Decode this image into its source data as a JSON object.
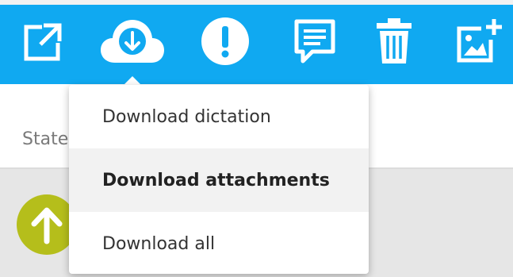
{
  "toolbar": {
    "background": "#10a9f1",
    "icon_color": "#ffffff",
    "buttons": [
      {
        "name": "open-external",
        "icon": "external-link-icon"
      },
      {
        "name": "download",
        "icon": "cloud-download-icon"
      },
      {
        "name": "priority",
        "icon": "exclamation-icon"
      },
      {
        "name": "comment",
        "icon": "comment-icon"
      },
      {
        "name": "delete",
        "icon": "trash-icon"
      },
      {
        "name": "add-image",
        "icon": "add-image-icon"
      }
    ]
  },
  "content": {
    "state_label": "State"
  },
  "download_menu": {
    "items": [
      {
        "label": "Download dictation",
        "active": false
      },
      {
        "label": "Download attachments",
        "active": true
      },
      {
        "label": "Download all",
        "active": false
      }
    ]
  },
  "list": {
    "status_icon": "arrow-up-icon",
    "status_color": "#b5be1b"
  }
}
